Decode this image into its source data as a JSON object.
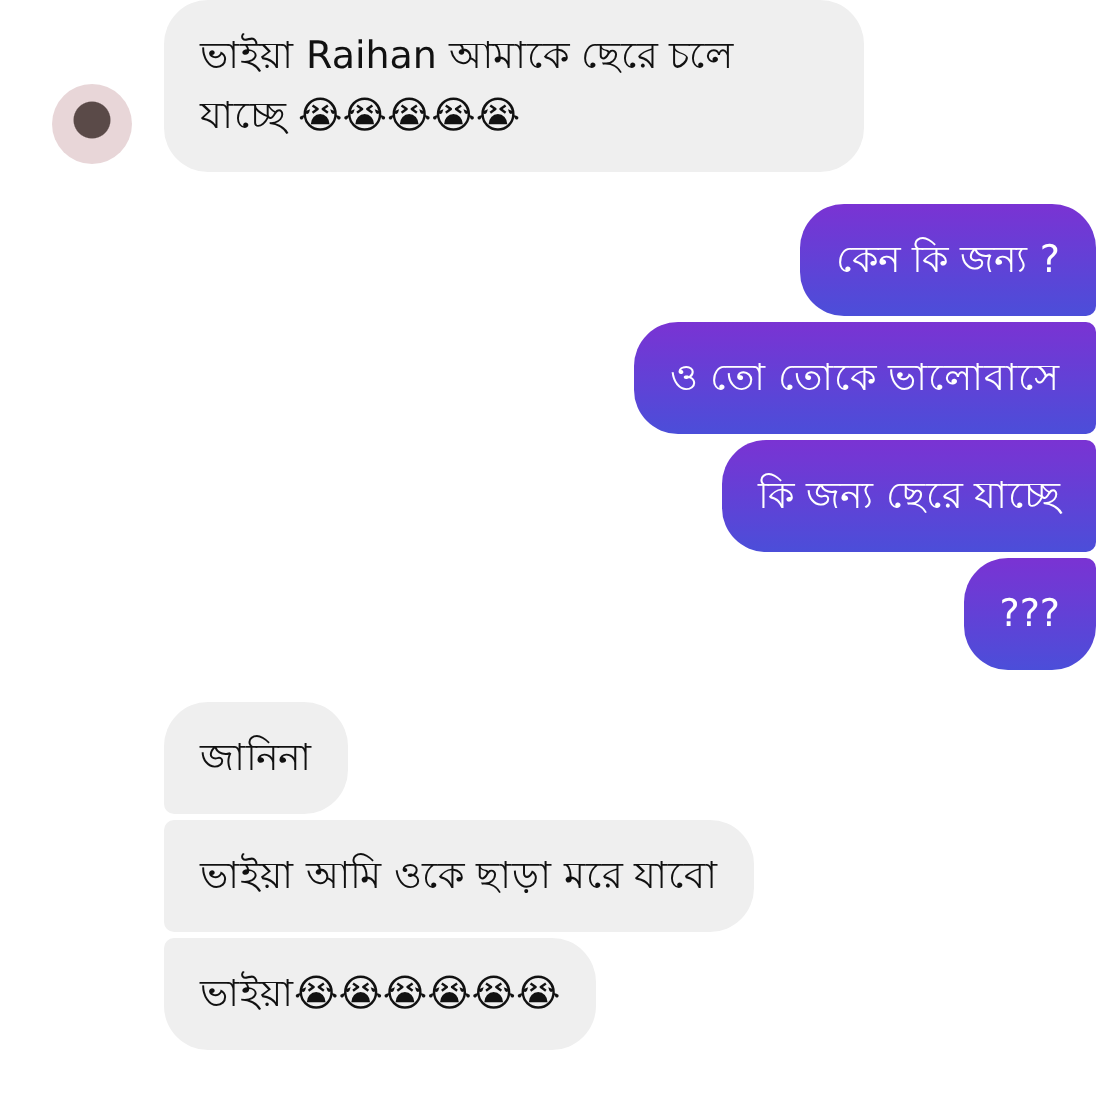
{
  "groups": [
    {
      "kind": "incoming",
      "avatar": true,
      "messages": [
        "ভাইয়া Raihan আমাকে ছেরে চলে যাচ্ছে 😭😭😭😭😭"
      ]
    },
    {
      "kind": "outgoing",
      "avatar": false,
      "messages": [
        "কেন কি জন্য ?",
        "ও তো তোকে ভালোবাসে",
        "কি জন্য ছেরে যাচ্ছে",
        "???"
      ]
    },
    {
      "kind": "incoming",
      "avatar": false,
      "messages": [
        "জানিনা",
        "ভাইয়া আমি ওকে ছাড়া মরে যাবো",
        "ভাইয়া😭😭😭😭😭😭"
      ]
    }
  ]
}
